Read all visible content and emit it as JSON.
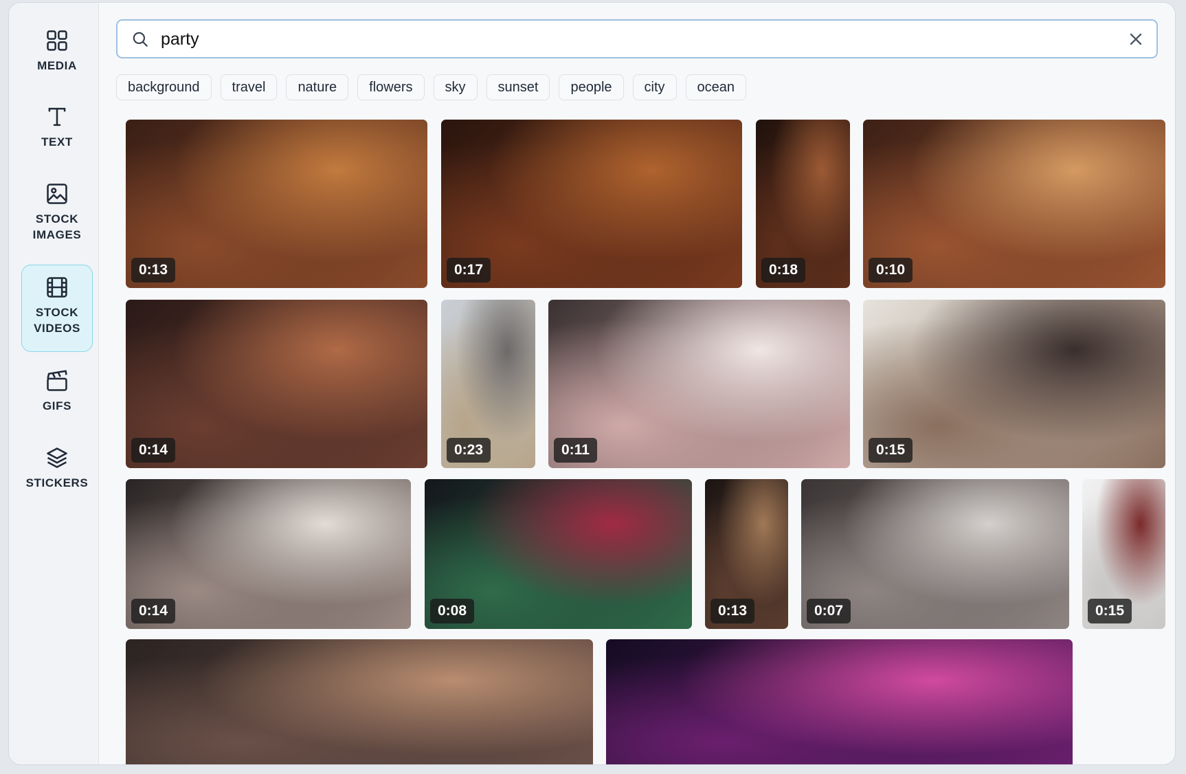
{
  "sidebar": {
    "items": [
      {
        "label": "MEDIA",
        "icon": "grid-icon",
        "active": false
      },
      {
        "label": "TEXT",
        "icon": "text-icon",
        "active": false
      },
      {
        "label": "STOCK IMAGES",
        "icon": "image-icon",
        "active": false
      },
      {
        "label": "STOCK VIDEOS",
        "icon": "film-icon",
        "active": true
      },
      {
        "label": "GIFS",
        "icon": "clapperboard-icon",
        "active": false
      },
      {
        "label": "STICKERS",
        "icon": "layers-icon",
        "active": false
      }
    ]
  },
  "search": {
    "value": "party",
    "icon": "search-icon",
    "clear_icon": "close-icon"
  },
  "tags": [
    "background",
    "travel",
    "nature",
    "flowers",
    "sky",
    "sunset",
    "people",
    "city",
    "ocean"
  ],
  "videos": [
    {
      "duration": "0:13",
      "colors": [
        "#3a1f16",
        "#8a4a2a",
        "#c27a3e"
      ]
    },
    {
      "duration": "0:17",
      "colors": [
        "#2a150e",
        "#7a3a1f",
        "#b0632e"
      ]
    },
    {
      "duration": "0:18",
      "colors": [
        "#21120d",
        "#5e2f1c",
        "#9c5a34"
      ]
    },
    {
      "duration": "0:10",
      "colors": [
        "#3d2016",
        "#9a5431",
        "#d59a62"
      ]
    },
    {
      "duration": "0:14",
      "colors": [
        "#2b1a18",
        "#6a3d30",
        "#b06a46"
      ]
    },
    {
      "duration": "0:23",
      "colors": [
        "#c9cfd6",
        "#b7a58a",
        "#6d6a6a"
      ]
    },
    {
      "duration": "0:11",
      "colors": [
        "#3b3233",
        "#cfa9a8",
        "#f0e6e4"
      ]
    },
    {
      "duration": "0:15",
      "colors": [
        "#e6e3dc",
        "#8a6f5e",
        "#3a2e2c"
      ]
    },
    {
      "duration": "0:14",
      "colors": [
        "#2a2525",
        "#9b8a84",
        "#e2dcd6"
      ]
    },
    {
      "duration": "0:08",
      "colors": [
        "#14171c",
        "#2f6b4a",
        "#a12a44"
      ]
    },
    {
      "duration": "0:13",
      "colors": [
        "#1c1513",
        "#5b3d2f",
        "#a07856"
      ]
    },
    {
      "duration": "0:07",
      "colors": [
        "#3b3535",
        "#8e8583",
        "#d4cfcc"
      ]
    },
    {
      "duration": "0:15",
      "colors": [
        "#f2f2f2",
        "#c9c7c6",
        "#7b2a2a"
      ]
    },
    {
      "duration": "",
      "colors": [
        "#2c2422",
        "#6a5048",
        "#b98d70"
      ]
    },
    {
      "duration": "",
      "colors": [
        "#150c24",
        "#6a1f6e",
        "#d14aa0"
      ]
    }
  ]
}
